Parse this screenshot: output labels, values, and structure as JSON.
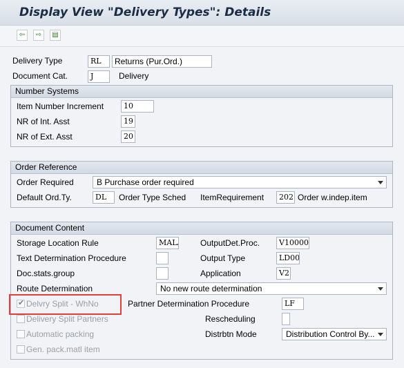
{
  "window": {
    "title": "Display View \"Delivery Types\": Details"
  },
  "toolbar": {
    "buttons": [
      {
        "name": "previous-entry-button",
        "glyph": "⇦"
      },
      {
        "name": "next-entry-button",
        "glyph": "⇨"
      },
      {
        "name": "other-entry-button",
        "glyph": "▤"
      }
    ]
  },
  "header": {
    "delivery_type_label": "Delivery Type",
    "delivery_type_value": "RL",
    "delivery_type_text": "Returns (Pur.Ord.)",
    "document_cat_label": "Document Cat.",
    "document_cat_value": "J",
    "document_cat_text": "Delivery"
  },
  "number_systems": {
    "title": "Number Systems",
    "item_number_increment_label": "Item Number Increment",
    "item_number_increment_value": "10",
    "nr_int_label": "NR of Int. Asst",
    "nr_int_value": "19",
    "nr_ext_label": "NR of Ext. Asst",
    "nr_ext_value": "20"
  },
  "order_reference": {
    "title": "Order Reference",
    "order_required_label": "Order Required",
    "order_required_value": "B Purchase order required",
    "default_ord_ty_label": "Default Ord.Ty.",
    "default_ord_ty_value": "DL",
    "order_type_sched_label": "Order Type Sched",
    "item_requirement_label": "ItemRequirement",
    "item_requirement_value": "202",
    "item_requirement_text": "Order w.indep.item"
  },
  "document_content": {
    "title": "Document Content",
    "storage_location_rule_label": "Storage Location Rule",
    "storage_location_rule_value": "MALA",
    "outputdet_proc_label": "OutputDet.Proc.",
    "outputdet_proc_value": "V10000",
    "text_determination_label": "Text Determination Procedure",
    "text_determination_value": "",
    "output_type_label": "Output Type",
    "output_type_value": "LD00",
    "doc_stats_group_label": "Doc.stats.group",
    "doc_stats_group_value": "",
    "application_label": "Application",
    "application_value": "V2",
    "route_determination_label": "Route Determination",
    "route_determination_value": "No new route determination",
    "delivery_split_whno_label": "Delvry Split - WhNo",
    "partner_determination_label": "Partner Determination Procedure",
    "partner_determination_value": "LF",
    "delivery_split_partners_label": "Delivery Split Partners",
    "rescheduling_label": "Rescheduling",
    "rescheduling_value": "",
    "automatic_packing_label": "Automatic packing",
    "distrbtn_mode_label": "Distrbtn Mode",
    "distrbtn_mode_value": "Distribution Control By...",
    "gen_pack_matl_label": "Gen. pack.matl item",
    "checkbox_mark": "✔"
  },
  "colors": {
    "highlight": "#e0403a",
    "title_text": "#1a2d44",
    "group_border": "#aab4c2"
  }
}
